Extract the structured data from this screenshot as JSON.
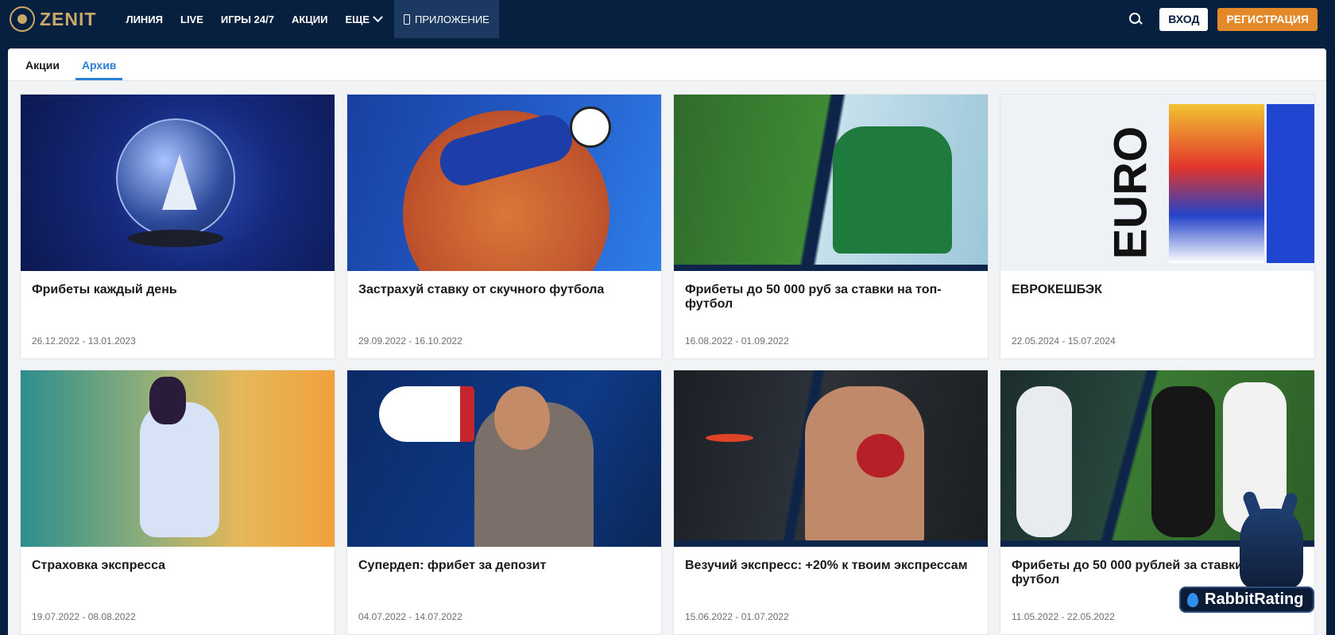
{
  "brand": {
    "logo_text": "ZENIT"
  },
  "nav": {
    "items": [
      "ЛИНИЯ",
      "LIVE",
      "ИГРЫ 24/7",
      "АКЦИИ",
      "ЕЩЕ"
    ],
    "app_label": "ПРИЛОЖЕНИЕ"
  },
  "header": {
    "login_label": "ВХОД",
    "register_label": "РЕГИСТРАЦИЯ"
  },
  "tabs": [
    {
      "label": "Акции",
      "active": false
    },
    {
      "label": "Архив",
      "active": true
    }
  ],
  "promos": [
    {
      "title": "Фрибеты каждый день",
      "dates": "26.12.2022 - 13.01.2023"
    },
    {
      "title": "Застрахуй ставку от скучного футбола",
      "dates": "29.09.2022 - 16.10.2022"
    },
    {
      "title": "Фрибеты до 50 000 руб за ставки на топ-футбол",
      "dates": "16.08.2022 - 01.09.2022"
    },
    {
      "title": "ЕВРОКЕШБЭК",
      "dates": "22.05.2024 - 15.07.2024",
      "image_text": "EURO"
    },
    {
      "title": "Страховка экспресса",
      "dates": "19.07.2022 - 08.08.2022"
    },
    {
      "title": "Супердеп: фрибет за депозит",
      "dates": "04.07.2022 - 14.07.2022"
    },
    {
      "title": "Везучий экспресс: +20% к твоим экспрессам",
      "dates": "15.06.2022 - 01.07.2022"
    },
    {
      "title": "Фрибеты до 50 000 рублей за ставки на футбол",
      "dates": "11.05.2022 - 22.05.2022"
    }
  ],
  "watermark": {
    "text": "RabbitRating"
  },
  "colors": {
    "header_bg": "#08203f",
    "accent_orange": "#e3892a",
    "active_tab": "#2b7fd4",
    "logo_gold": "#c9a86a"
  }
}
